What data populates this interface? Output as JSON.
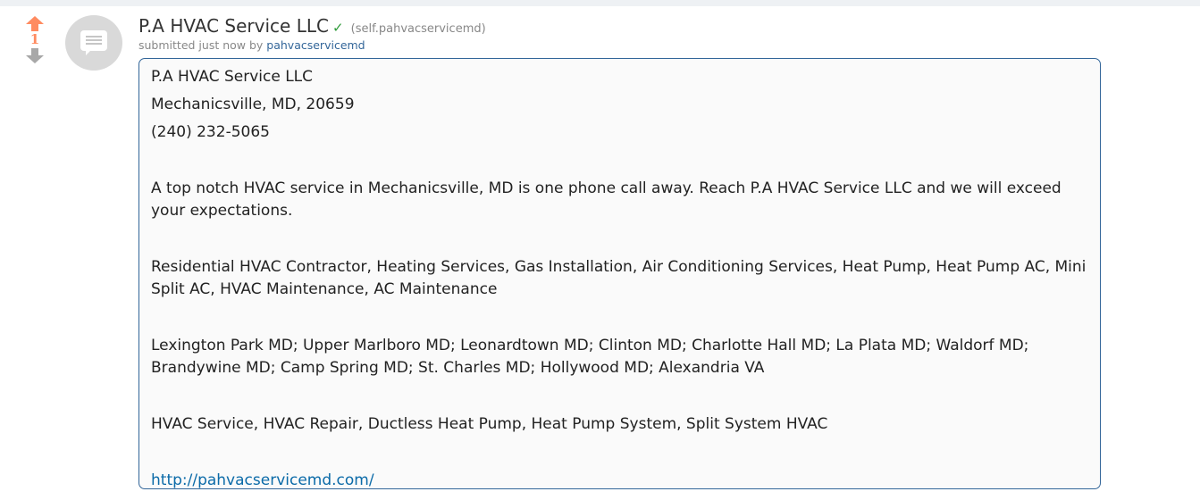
{
  "post": {
    "score": "1",
    "title": "P.A HVAC Service LLC",
    "verified_mark": "✓",
    "domain": "(self.pahvacservicemd)",
    "submitted_prefix": "submitted just now by ",
    "author": "pahvacservicemd"
  },
  "selftext": {
    "name": "P.A HVAC Service LLC",
    "address": "Mechanicsville, MD, 20659",
    "phone": "(240) 232-5065",
    "intro": "A top notch HVAC service in Mechanicsville, MD is one phone call away. Reach P.A HVAC Service LLC and we will exceed your expectations.",
    "services": "Residential HVAC Contractor, Heating Services, Gas Installation, Air Conditioning Services, Heat Pump, Heat Pump AC, Mini Split AC, HVAC Maintenance, AC Maintenance",
    "areas": "Lexington Park MD; Upper Marlboro MD; Leonardtown MD; Clinton MD; Charlotte Hall MD; La Plata MD; Waldorf MD; Brandywine MD; Camp Spring MD; St. Charles MD; Hollywood MD; Alexandria VA",
    "keywords": "HVAC Service, HVAC Repair, Ductless Heat Pump, Heat Pump System, Split System HVAC",
    "website": "http://pahvacservicemd.com/"
  },
  "colors": {
    "upvote": "#ff8b60",
    "downvote": "#a8a8a8",
    "link": "#0a6aa8",
    "border": "#336699"
  },
  "icons": {
    "upvote": "upvote-arrow-icon",
    "downvote": "downvote-arrow-icon",
    "thumbnail": "self-post-text-icon",
    "verified": "checkmark-icon"
  }
}
